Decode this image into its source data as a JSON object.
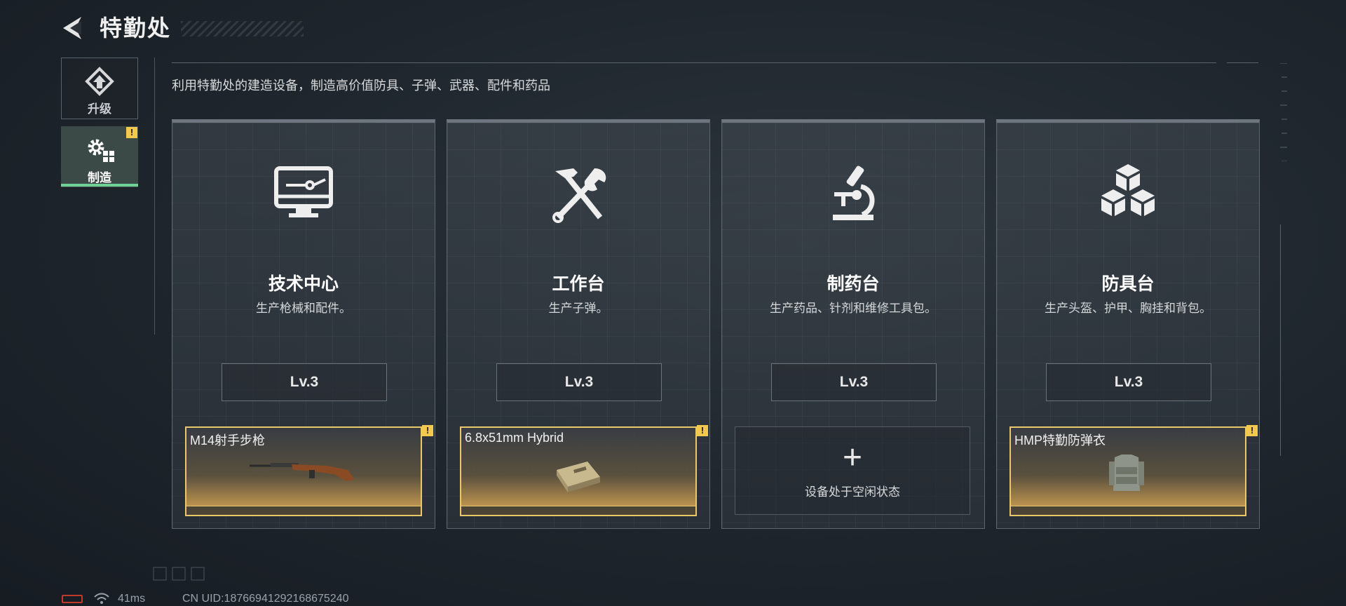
{
  "header": {
    "title": "特勤处"
  },
  "sidebar": {
    "items": [
      {
        "label": "升级",
        "icon": "upgrade-icon",
        "active": false
      },
      {
        "label": "制造",
        "icon": "gear-grid-icon",
        "active": true,
        "alert": "!"
      }
    ]
  },
  "subtitle": "利用特勤处的建造设备，制造高价值防具、子弹、武器、配件和药品",
  "stations": [
    {
      "name": "技术中心",
      "desc": "生产枪械和配件。",
      "level": "Lv.3",
      "icon": "monitor-icon",
      "slot": {
        "state": "active",
        "item": "M14射手步枪",
        "item_icon": "rifle-icon",
        "alert": "!"
      }
    },
    {
      "name": "工作台",
      "desc": "生产子弹。",
      "level": "Lv.3",
      "icon": "hammer-wrench-icon",
      "slot": {
        "state": "active",
        "item": "6.8x51mm Hybrid",
        "item_icon": "ammo-box-icon",
        "alert": "!"
      }
    },
    {
      "name": "制药台",
      "desc": "生产药品、针剂和维修工具包。",
      "level": "Lv.3",
      "icon": "microscope-icon",
      "slot": {
        "state": "idle",
        "plus": "+",
        "idle_text": "设备处于空闲状态"
      }
    },
    {
      "name": "防具台",
      "desc": "生产头盔、护甲、胸挂和背包。",
      "level": "Lv.3",
      "icon": "boxes-icon",
      "slot": {
        "state": "active",
        "item": "HMP特勤防弹衣",
        "item_icon": "body-armor-icon",
        "alert": "!"
      }
    }
  ],
  "status_bar": {
    "ping": "41ms",
    "uid": "CN UID:18766941292168675240"
  },
  "colors": {
    "accent_gold": "#e9c868",
    "active_green": "#6fd196",
    "alert_yellow": "#f2c94c",
    "battery_red": "#c0392b"
  }
}
